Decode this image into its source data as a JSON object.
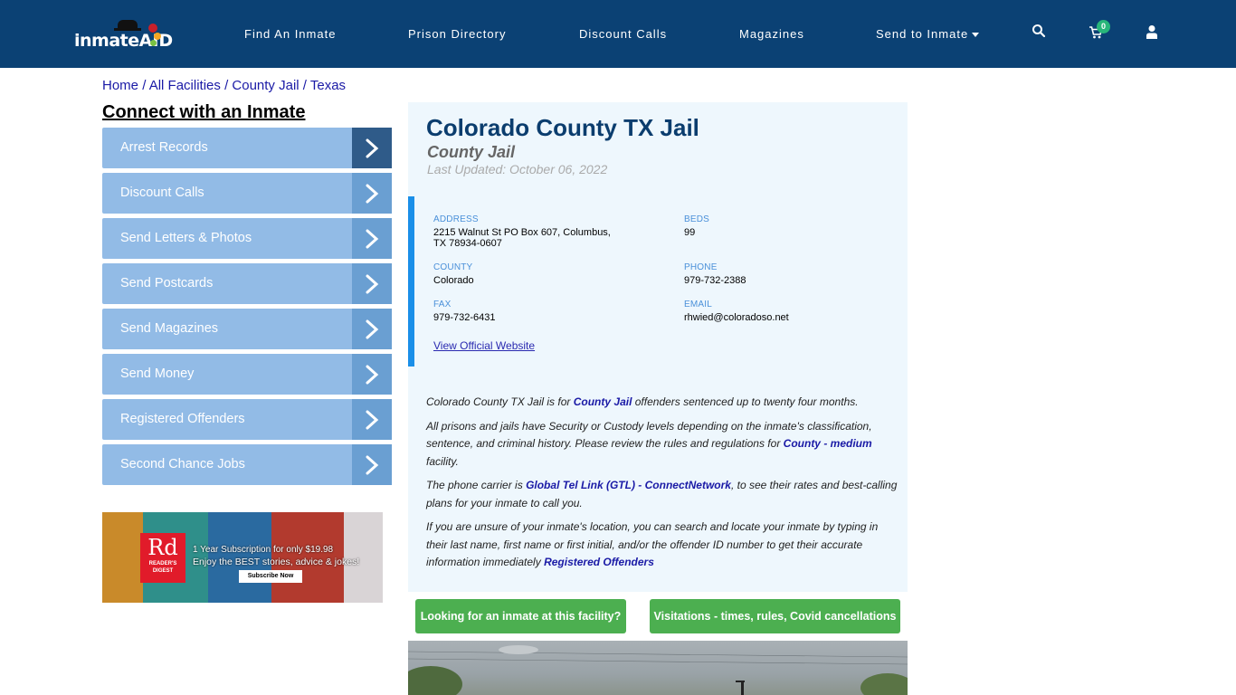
{
  "header": {
    "logo_text": "inmate",
    "logo_accent": "AID",
    "nav": [
      {
        "label": "Find An Inmate"
      },
      {
        "label": "Prison Directory"
      },
      {
        "label": "Discount Calls"
      },
      {
        "label": "Magazines"
      },
      {
        "label": "Send to Inmate",
        "has_dropdown": true
      }
    ],
    "icons": {
      "search": "search-icon",
      "cart": "cart-icon",
      "user": "user-icon"
    },
    "cart_count": "0"
  },
  "breadcrumb": [
    {
      "label": "Home"
    },
    {
      "label": "All Facilities"
    },
    {
      "label": "County Jail"
    },
    {
      "label": "Texas"
    }
  ],
  "breadcrumb_separator": "/",
  "sidebar": {
    "title": "Connect with an Inmate",
    "items": [
      {
        "label": "Arrest Records"
      },
      {
        "label": "Discount Calls"
      },
      {
        "label": "Send Letters & Photos"
      },
      {
        "label": "Send Postcards"
      },
      {
        "label": "Send Magazines"
      },
      {
        "label": "Send Money"
      },
      {
        "label": "Registered Offenders"
      },
      {
        "label": "Second Chance Jobs"
      }
    ],
    "ad": {
      "brand_short": "Rd",
      "brand_name": "READER'S DIGEST",
      "line1": "1 Year Subscription for only $19.98",
      "line2": "Enjoy the BEST stories, advice & jokes!",
      "button": "Subscribe Now"
    }
  },
  "facility": {
    "title": "Colorado County TX Jail",
    "type": "County Jail",
    "last_updated": "Last Updated: October 06, 2022",
    "address_label": "ADDRESS",
    "address_line1": "2215 Walnut St PO Box 607, Columbus,",
    "address_line2": "TX 78934-0607",
    "beds_label": "BEDS",
    "beds": "99",
    "county_label": "COUNTY",
    "county": "Colorado",
    "phone_label": "PHONE",
    "phone": "979-732-2388",
    "fax_label": "FAX",
    "fax": "979-732-6431",
    "email_label": "EMAIL",
    "email": "rhwied@coloradoso.net",
    "website_link": "View Official Website"
  },
  "description": {
    "p1_a": "Colorado County TX Jail is for ",
    "p1_link": "County Jail",
    "p1_b": " offenders sentenced up to twenty four months.",
    "p2_a": "All prisons and jails have Security or Custody levels depending on the inmate's classification, sentence, and criminal history. Please review the rules and regulations for ",
    "p2_link": "County - medium",
    "p2_b": " facility.",
    "p3_a": "The phone carrier is ",
    "p3_link": "Global Tel Link (GTL) - ConnectNetwork",
    "p3_b": ", to see their rates and best-calling plans for your inmate to call you.",
    "p4_a": "If you are unsure of your inmate's location, you can search and locate your inmate by typing in their last name, first name or first initial, and/or the offender ID number to get their accurate information immediately ",
    "p4_link": "Registered Offenders"
  },
  "buttons": {
    "find_inmate": "Looking for an inmate at this facility?",
    "visitations": "Visitations - times, rules, Covid cancellations"
  },
  "colors": {
    "nav_bg": "#0b4174",
    "sidebar_item": "#92bbe6",
    "sidebar_arrow": "#6a9fd2",
    "sidebar_arrow_active": "#2f5b89",
    "card_bg": "#eef7fd",
    "accent_bar": "#1a8fe8",
    "green_button": "#4caf50",
    "link": "#1a1aa6"
  }
}
